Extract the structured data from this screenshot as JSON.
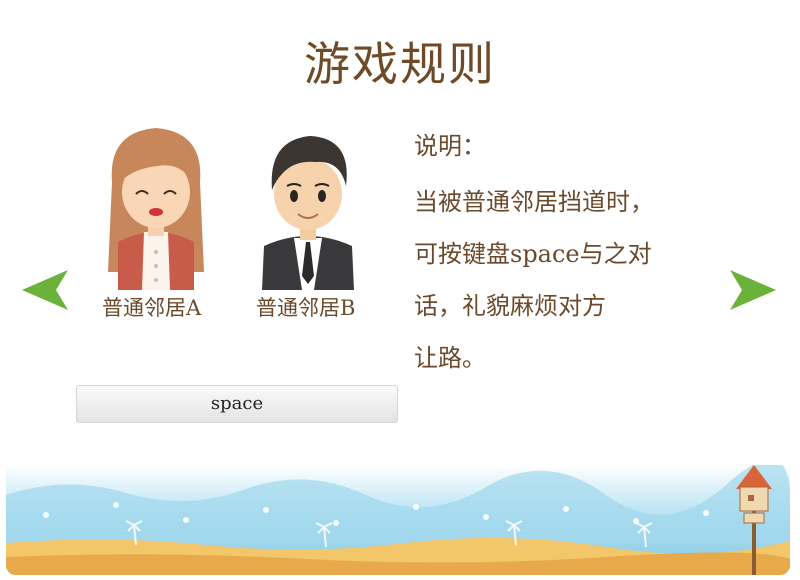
{
  "title": "游戏规则",
  "characters": [
    {
      "id": "a",
      "name": "普通邻居A"
    },
    {
      "id": "b",
      "name": "普通邻居B"
    }
  ],
  "key_button": {
    "label": "space"
  },
  "description": {
    "heading": "说明：",
    "lines": [
      "当被普通邻居挡道时，",
      "可按键盘space与之对",
      "话，礼貌麻烦对方",
      "让路。"
    ]
  },
  "colors": {
    "title": "#6e4a26",
    "text": "#6b4a2b",
    "arrow": "#6ab23a",
    "sky": "#8ecfe8",
    "sand": "#f3c66a"
  },
  "icons": {
    "prev": "arrow-left-icon",
    "next": "arrow-right-icon",
    "house": "birdhouse-icon"
  }
}
